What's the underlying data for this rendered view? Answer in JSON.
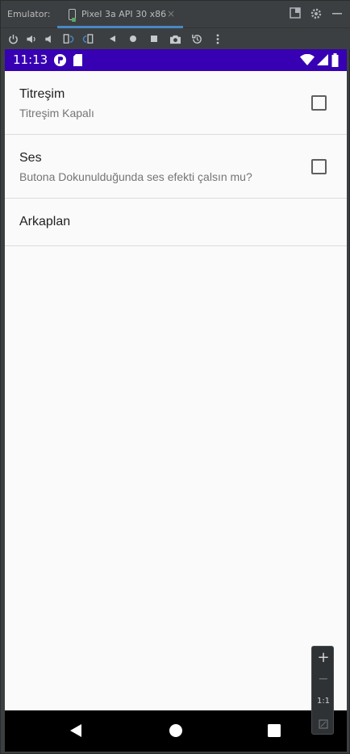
{
  "emulator": {
    "title": "Emulator:",
    "tab_label": "Pixel 3a API 30 x86",
    "tab_close": "×"
  },
  "toolbar": {
    "icons": [
      "power-icon",
      "volume-up-icon",
      "volume-down-icon",
      "rotate-left-icon",
      "rotate-right-icon",
      "back-icon",
      "home-icon",
      "overview-icon",
      "camera-icon",
      "snapshot-icon",
      "more-icon"
    ]
  },
  "status_bar": {
    "time": "11:13",
    "color": "#3700b3"
  },
  "preferences": [
    {
      "title": "Titreşim",
      "summary": "Titreşim Kapalı",
      "checked": false
    },
    {
      "title": "Ses",
      "summary": "Butona Dokunulduğunda ses efekti çalsın mu?",
      "checked": false
    },
    {
      "title": "Arkaplan",
      "summary": ""
    }
  ],
  "zoom_controls": {
    "zoom_in": "+",
    "zoom_out": "−",
    "actual_size": "1:1"
  }
}
